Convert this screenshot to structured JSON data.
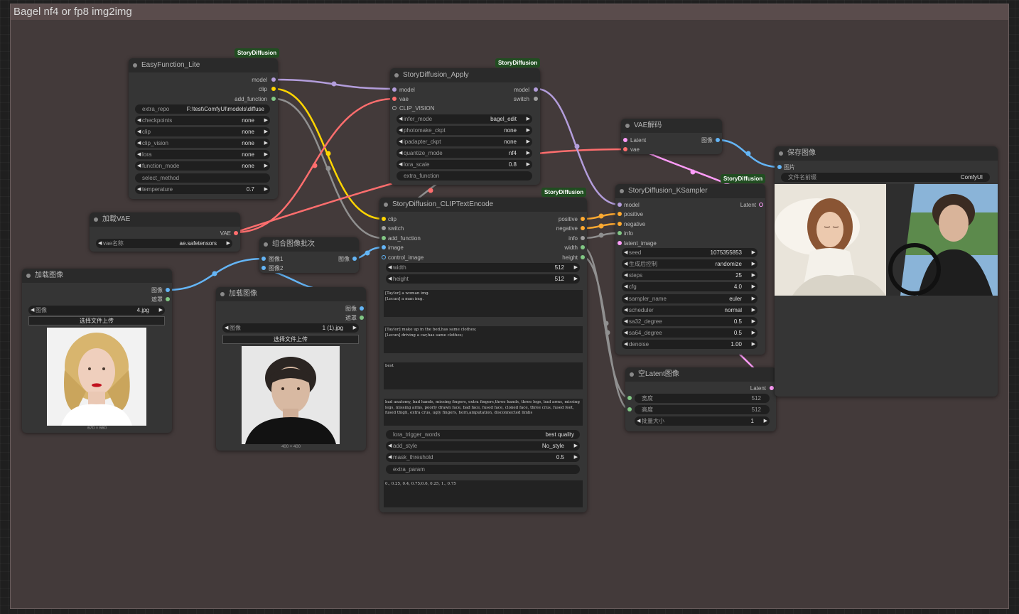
{
  "group": {
    "title": "Bagel nf4 or fp8 img2img"
  },
  "colors": {
    "model": "#b39ddb",
    "clip": "#ffd500",
    "vae": "#ff6e6e",
    "image": "#64b5f6",
    "conditioning": "#ffa931",
    "latent": "#ff9cf9",
    "info": "#9e9e9e",
    "mask": "#81c784"
  },
  "badge": "StoryDiffusion",
  "easy": {
    "title": "EasyFunction_Lite",
    "out": {
      "model": "model",
      "clip": "clip",
      "add_function": "add_function"
    },
    "repo": {
      "label": "extra_repo",
      "value": "F:\\test\\ComfyUI\\models\\diffuse"
    },
    "checkpoints": {
      "label": "checkpoints",
      "value": "none"
    },
    "clip": {
      "label": "clip",
      "value": "none"
    },
    "clip_vision": {
      "label": "clip_vision",
      "value": "none"
    },
    "lora": {
      "label": "lora",
      "value": "none"
    },
    "function_mode": {
      "label": "function_mode",
      "value": "none"
    },
    "select_method": {
      "label": "select_method"
    },
    "temperature": {
      "label": "temperature",
      "value": "0.7"
    }
  },
  "vaeload": {
    "title": "加载VAE",
    "out": "VAE",
    "w": {
      "label": "vae名称",
      "value": "ae.safetensors"
    }
  },
  "load1": {
    "title": "加载图像",
    "out1": "图像",
    "out2": "遮罩",
    "w": {
      "label": "图像",
      "value": "4.jpg"
    },
    "upload": "选择文件上传",
    "size": "670 × 660"
  },
  "load2": {
    "title": "加载图像",
    "out1": "图像",
    "out2": "遮罩",
    "w": {
      "label": "图像",
      "value": "1 (1).jpg"
    },
    "upload": "选择文件上传",
    "size": "400 × 400"
  },
  "combine": {
    "title": "组合图像批次",
    "in1": "图像1",
    "in2": "图像2",
    "out": "图像"
  },
  "apply": {
    "title": "StoryDiffusion_Apply",
    "in": {
      "model": "model",
      "vae": "vae",
      "clip_vision": "CLIP_VISION"
    },
    "out": {
      "model": "model",
      "switch": "switch"
    },
    "infer_mode": {
      "label": "infer_mode",
      "value": "bagel_edit"
    },
    "photomake": {
      "label": "photomake_ckpt",
      "value": "none"
    },
    "ipadapter": {
      "label": "ipadapter_ckpt",
      "value": "none"
    },
    "quantize": {
      "label": "quantize_mode",
      "value": "nf4"
    },
    "lora_scale": {
      "label": "lora_scale",
      "value": "0.8"
    },
    "extra_function": {
      "label": "extra_function"
    }
  },
  "encode": {
    "title": "StoryDiffusion_CLIPTextEncode",
    "in": {
      "clip": "clip",
      "switch": "switch",
      "add_function": "add_function",
      "image": "image",
      "control_image": "control_image"
    },
    "out": {
      "positive": "positive",
      "negative": "negative",
      "info": "info",
      "width": "width",
      "height": "height"
    },
    "width": {
      "label": "width",
      "value": "512"
    },
    "height": {
      "label": "height",
      "value": "512"
    },
    "text1": "[Taylor] a woman img.\n[Lecun] a man img.",
    "text2": "[Taylor] make up in the bed,has same clothes;\n[Lecun] driving a car,has same clothes;",
    "text3": "best",
    "text4": "bad anatomy, bad hands, missing fingers, extra fingers,three hands, three legs, bad arms, missing legs, missing arms, poorly drawn face, bad face, fused face, cloned face, three crus, fused feet, fused thigh, extra crus, ugly fingers, horn,amputation, disconnected limbs",
    "lora_trigger": {
      "label": "lora_trigger_words",
      "value": "best quality"
    },
    "add_style": {
      "label": "add_style",
      "value": "No_style"
    },
    "mask_threshold": {
      "label": "mask_threshold",
      "value": "0.5"
    },
    "extra_param": {
      "label": "extra_param"
    },
    "text5": "0., 0.25, 0.4, 0.75;0.6, 0.25, 1., 0.75"
  },
  "vaedec": {
    "title": "VAE解码",
    "in1": "Latent",
    "in2": "vae",
    "out": "图像"
  },
  "ksampler": {
    "title": "StoryDiffusion_KSampler",
    "in": {
      "model": "model",
      "positive": "positive",
      "negative": "negative",
      "info": "info",
      "latent_image": "latent_image"
    },
    "out": "Latent",
    "seed": {
      "label": "seed",
      "value": "1075355853"
    },
    "control": {
      "label": "生成后控制",
      "value": "randomize"
    },
    "steps": {
      "label": "steps",
      "value": "25"
    },
    "cfg": {
      "label": "cfg",
      "value": "4.0"
    },
    "sampler": {
      "label": "sampler_name",
      "value": "euler"
    },
    "scheduler": {
      "label": "scheduler",
      "value": "normal"
    },
    "sa32": {
      "label": "sa32_degree",
      "value": "0.5"
    },
    "sa64": {
      "label": "sa64_degree",
      "value": "0.5"
    },
    "denoise": {
      "label": "denoise",
      "value": "1.00"
    }
  },
  "emptylatent": {
    "title": "空Latent图像",
    "out": "Latent",
    "width": {
      "label": "宽度",
      "value": "512"
    },
    "height": {
      "label": "高度",
      "value": "512"
    },
    "batch": {
      "label": "批量大小",
      "value": "1"
    }
  },
  "save": {
    "title": "保存图像",
    "in": "图片",
    "prefix": {
      "label": "文件名前缀",
      "value": "ComfyUI"
    }
  }
}
